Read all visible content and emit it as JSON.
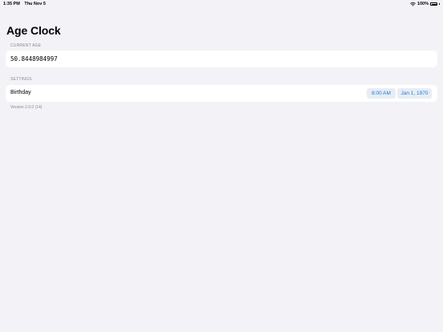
{
  "status_bar": {
    "time": "1:35 PM",
    "date": "Thu Nov 5",
    "battery_percent": "100%",
    "battery_level": 1.0
  },
  "app": {
    "title": "Age Clock"
  },
  "current_age": {
    "header": "CURRENT AGE",
    "value": "50.8448984997"
  },
  "settings": {
    "header": "SETTINGS",
    "birthday_label": "Birthday",
    "birthday_time": "8:00 AM",
    "birthday_date": "Jan 1, 1970"
  },
  "footer": {
    "version": "Version 2.0.0 (14)"
  },
  "colors": {
    "background": "#f2f2f7",
    "accent": "#1a7ae0",
    "secondary_text": "#8a8a8e"
  }
}
